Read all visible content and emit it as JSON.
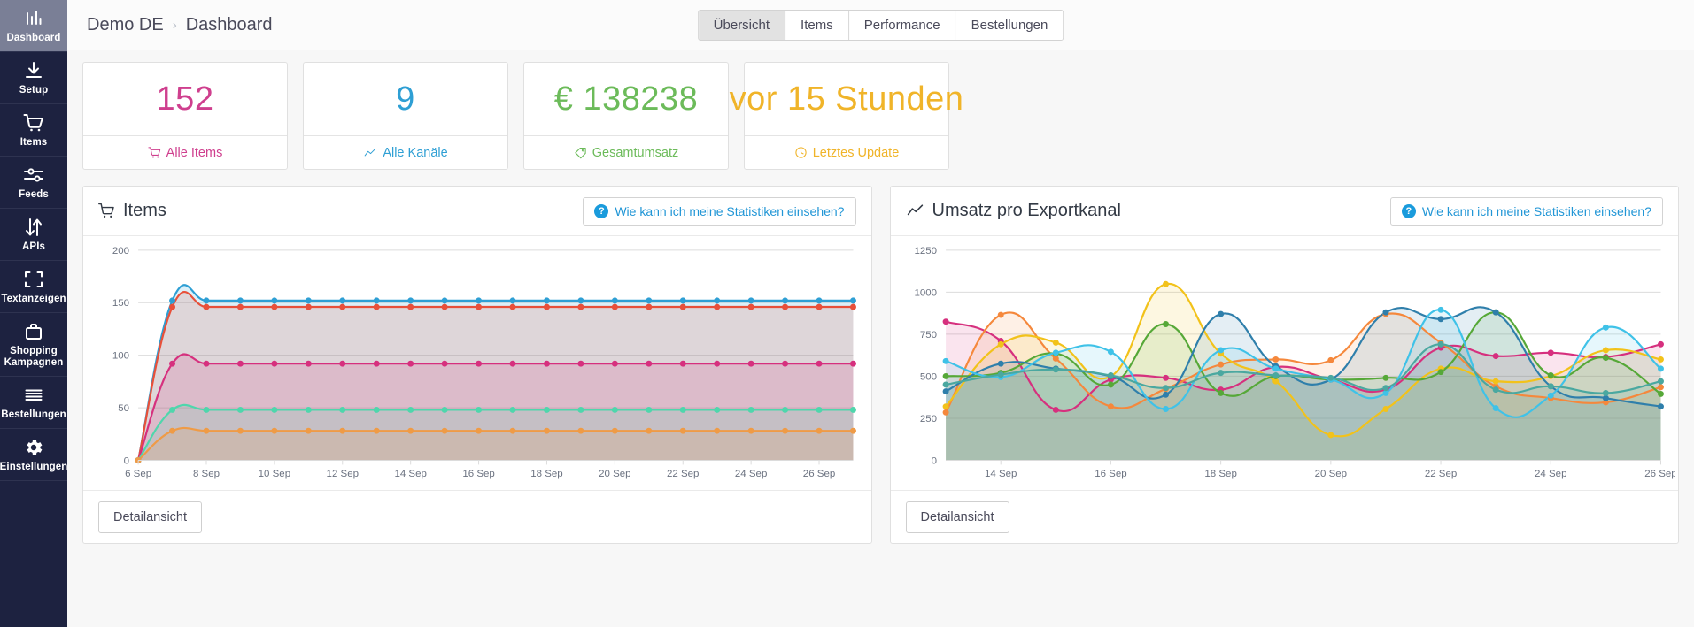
{
  "sidebar": {
    "items": [
      {
        "label": "Dashboard",
        "icon": "bar-chart-icon",
        "active": true
      },
      {
        "label": "Setup",
        "icon": "download-icon",
        "active": false
      },
      {
        "label": "Items",
        "icon": "cart-icon",
        "active": false
      },
      {
        "label": "Feeds",
        "icon": "sliders-icon",
        "active": false
      },
      {
        "label": "APIs",
        "icon": "arrows-updown-icon",
        "active": false
      },
      {
        "label": "Textanzeigen",
        "icon": "crop-frame-icon",
        "active": false
      },
      {
        "label": "Shopping Kampagnen",
        "icon": "briefcase-icon",
        "active": false
      },
      {
        "label": "Bestellungen",
        "icon": "list-lines-icon",
        "active": false
      },
      {
        "label": "Einstellungen",
        "icon": "gear-icon",
        "active": false
      }
    ]
  },
  "topbar": {
    "breadcrumb": {
      "root": "Demo DE",
      "separator": "›",
      "current": "Dashboard"
    },
    "tabs": [
      {
        "label": "Übersicht",
        "active": true
      },
      {
        "label": "Items",
        "active": false
      },
      {
        "label": "Performance",
        "active": false
      },
      {
        "label": "Bestellungen",
        "active": false
      }
    ]
  },
  "kpis": [
    {
      "value": "152",
      "label": "Alle Items",
      "icon": "cart-icon",
      "color": "#cf3f8e"
    },
    {
      "value": "9",
      "label": "Alle Kanäle",
      "icon": "trend-icon",
      "color": "#2e9fd4"
    },
    {
      "value": "€ 138238",
      "label": "Gesamtumsatz",
      "icon": "tag-icon",
      "color": "#6cbb5a"
    },
    {
      "value": "vor 15 Stunden",
      "label": "Letztes Update",
      "icon": "clock-icon",
      "color": "#f0b429"
    }
  ],
  "panels": [
    {
      "title": "Items",
      "title_icon": "cart-icon",
      "help_label": "Wie kann ich meine Statistiken einsehen?",
      "help_icon": "question-circle-icon",
      "detail_label": "Detailansicht"
    },
    {
      "title": "Umsatz pro Exportkanal",
      "title_icon": "trend-icon",
      "help_label": "Wie kann ich meine Statistiken einsehen?",
      "help_icon": "question-circle-icon",
      "detail_label": "Detailansicht"
    }
  ],
  "chart_data": [
    {
      "id": "items-chart",
      "type": "area",
      "title": "Items",
      "xlabel": "",
      "ylabel": "",
      "ylim": [
        0,
        200
      ],
      "yticks": [
        0,
        50,
        100,
        150,
        200
      ],
      "grid": true,
      "legend": "none",
      "x": [
        "6 Sep",
        "7 Sep",
        "8 Sep",
        "9 Sep",
        "10 Sep",
        "11 Sep",
        "12 Sep",
        "13 Sep",
        "14 Sep",
        "15 Sep",
        "16 Sep",
        "17 Sep",
        "18 Sep",
        "19 Sep",
        "20 Sep",
        "21 Sep",
        "22 Sep",
        "23 Sep",
        "24 Sep",
        "25 Sep",
        "26 Sep",
        "27 Sep"
      ],
      "xtick_labels": [
        "6 Sep",
        "8 Sep",
        "10 Sep",
        "12 Sep",
        "14 Sep",
        "16 Sep",
        "18 Sep",
        "20 Sep",
        "22 Sep",
        "24 Sep",
        "26 Sep"
      ],
      "series": [
        {
          "name": "series-1",
          "color": "#2e9fd4",
          "values": [
            0,
            152,
            152,
            152,
            152,
            152,
            152,
            152,
            152,
            152,
            152,
            152,
            152,
            152,
            152,
            152,
            152,
            152,
            152,
            152,
            152,
            152
          ]
        },
        {
          "name": "series-2",
          "color": "#e8503a",
          "values": [
            0,
            146,
            146,
            146,
            146,
            146,
            146,
            146,
            146,
            146,
            146,
            146,
            146,
            146,
            146,
            146,
            146,
            146,
            146,
            146,
            146,
            146
          ]
        },
        {
          "name": "series-3",
          "color": "#d6307e",
          "values": [
            0,
            92,
            92,
            92,
            92,
            92,
            92,
            92,
            92,
            92,
            92,
            92,
            92,
            92,
            92,
            92,
            92,
            92,
            92,
            92,
            92,
            92
          ]
        },
        {
          "name": "series-4",
          "color": "#4fd6ac",
          "values": [
            0,
            48,
            48,
            48,
            48,
            48,
            48,
            48,
            48,
            48,
            48,
            48,
            48,
            48,
            48,
            48,
            48,
            48,
            48,
            48,
            48,
            48
          ]
        },
        {
          "name": "series-5",
          "color": "#ef9b46",
          "values": [
            0,
            28,
            28,
            28,
            28,
            28,
            28,
            28,
            28,
            28,
            28,
            28,
            28,
            28,
            28,
            28,
            28,
            28,
            28,
            28,
            28,
            28
          ]
        }
      ]
    },
    {
      "id": "revenue-per-channel-chart",
      "type": "area",
      "title": "Umsatz pro Exportkanal",
      "xlabel": "",
      "ylabel": "",
      "ylim": [
        0,
        1250
      ],
      "yticks": [
        0,
        250,
        500,
        750,
        1000,
        1250
      ],
      "grid": true,
      "legend": "none",
      "x": [
        "13 Sep",
        "14 Sep",
        "15 Sep",
        "16 Sep",
        "17 Sep",
        "18 Sep",
        "19 Sep",
        "20 Sep",
        "21 Sep",
        "22 Sep",
        "23 Sep",
        "24 Sep",
        "25 Sep",
        "26 Sep"
      ],
      "xtick_labels": [
        "14 Sep",
        "16 Sep",
        "18 Sep",
        "20 Sep",
        "22 Sep",
        "24 Sep",
        "26 Sep"
      ],
      "series": [
        {
          "name": "series-magenta",
          "color": "#d6307e",
          "values": [
            825,
            710,
            300,
            480,
            490,
            420,
            555,
            480,
            420,
            670,
            620,
            640,
            615,
            690
          ]
        },
        {
          "name": "series-orange",
          "color": "#f5883c",
          "values": [
            285,
            865,
            605,
            320,
            425,
            570,
            600,
            595,
            870,
            700,
            440,
            370,
            345,
            435
          ]
        },
        {
          "name": "series-yellow",
          "color": "#f2c21a",
          "values": [
            320,
            690,
            700,
            500,
            1048,
            635,
            470,
            150,
            305,
            545,
            470,
            500,
            655,
            600
          ]
        },
        {
          "name": "series-green",
          "color": "#56a838",
          "values": [
            500,
            520,
            635,
            450,
            810,
            400,
            500,
            480,
            490,
            525,
            880,
            505,
            610,
            395
          ]
        },
        {
          "name": "series-blue",
          "color": "#2f7fab",
          "values": [
            410,
            575,
            545,
            500,
            390,
            870,
            560,
            480,
            880,
            840,
            880,
            440,
            370,
            320
          ]
        },
        {
          "name": "series-cyan",
          "color": "#3fc2e8",
          "values": [
            590,
            495,
            640,
            645,
            305,
            655,
            545,
            480,
            400,
            895,
            310,
            385,
            790,
            545
          ]
        },
        {
          "name": "series-teal",
          "color": "#4aa8a0",
          "values": [
            450,
            510,
            540,
            505,
            430,
            520,
            505,
            490,
            430,
            690,
            420,
            440,
            400,
            470
          ]
        }
      ]
    }
  ]
}
